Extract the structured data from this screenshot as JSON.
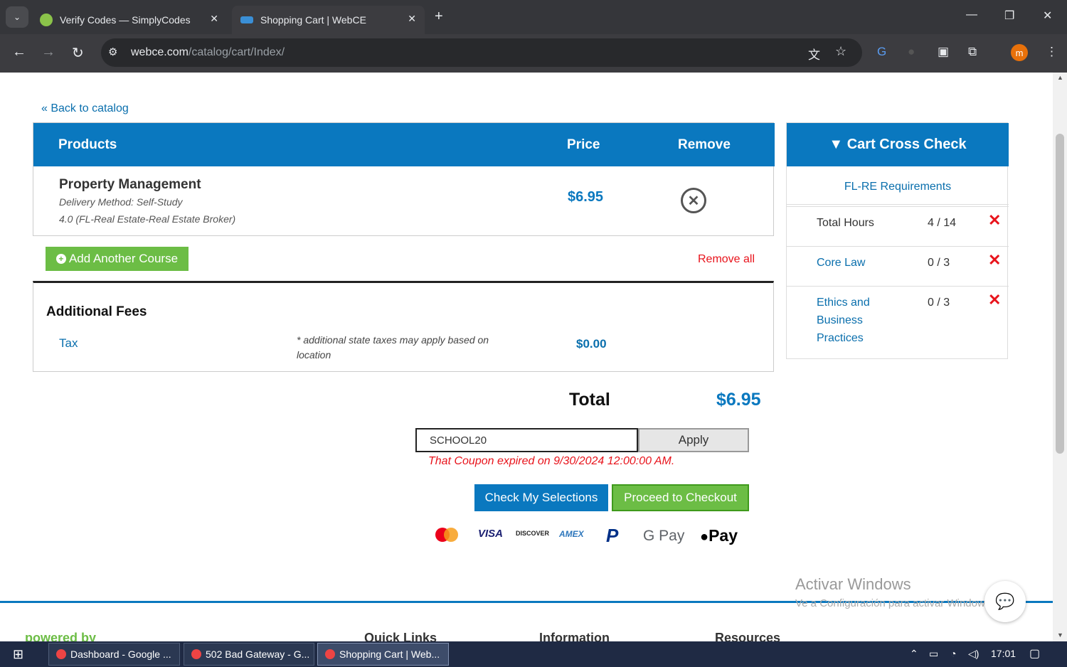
{
  "browser": {
    "tabs": [
      {
        "title": "Verify Codes — SimplyCodes",
        "active": false
      },
      {
        "title": "Shopping Cart | WebCE",
        "active": true
      }
    ],
    "url_host": "webce.com",
    "url_path": "/catalog/cart/Index/",
    "profile_initial": "m"
  },
  "page": {
    "back_link": "« Back to catalog",
    "cart": {
      "headers": {
        "products": "Products",
        "price": "Price",
        "remove": "Remove"
      },
      "items": [
        {
          "name": "Property Management",
          "delivery": "Delivery Method: Self-Study",
          "credits": "4.0 (FL-Real Estate-Real Estate Broker)",
          "price": "$6.95"
        }
      ],
      "add_course": "Add Another Course",
      "remove_all": "Remove all"
    },
    "fees": {
      "title": "Additional Fees",
      "tax_label": "Tax",
      "tax_note": "* additional state taxes may apply based on location",
      "tax_value": "$0.00"
    },
    "total": {
      "label": "Total",
      "value": "$6.95"
    },
    "coupon": {
      "value": "SCHOOL20",
      "apply_label": "Apply",
      "error": "That Coupon expired on 9/30/2024 12:00:00 AM."
    },
    "actions": {
      "check_selections": "Check My Selections",
      "checkout": "Proceed to Checkout"
    },
    "payment_methods": [
      "VISA",
      "DISCOVER",
      "AMEX",
      "G Pay",
      "Pay"
    ],
    "cross_check": {
      "title": "▼ Cart Cross Check",
      "requirements_link": "FL-RE Requirements",
      "rows": [
        {
          "label": "Total Hours",
          "value": "4 / 14",
          "status": "✕"
        },
        {
          "label": "Core Law",
          "value": "0 / 3",
          "status": "✕"
        },
        {
          "label": "Ethics and Business Practices",
          "value": "0 / 3",
          "status": "✕"
        }
      ]
    },
    "footer": {
      "powered_by": "powered by",
      "quick_links": "Quick Links",
      "information": "Information",
      "resources": "Resources"
    },
    "watermark": {
      "title": "Activar Windows",
      "subtitle": "Ve a Configuración para activar Windows."
    }
  },
  "taskbar": {
    "items": [
      "Dashboard - Google ...",
      "502 Bad Gateway - G...",
      "Shopping Cart | Web..."
    ],
    "clock": "17:01"
  }
}
